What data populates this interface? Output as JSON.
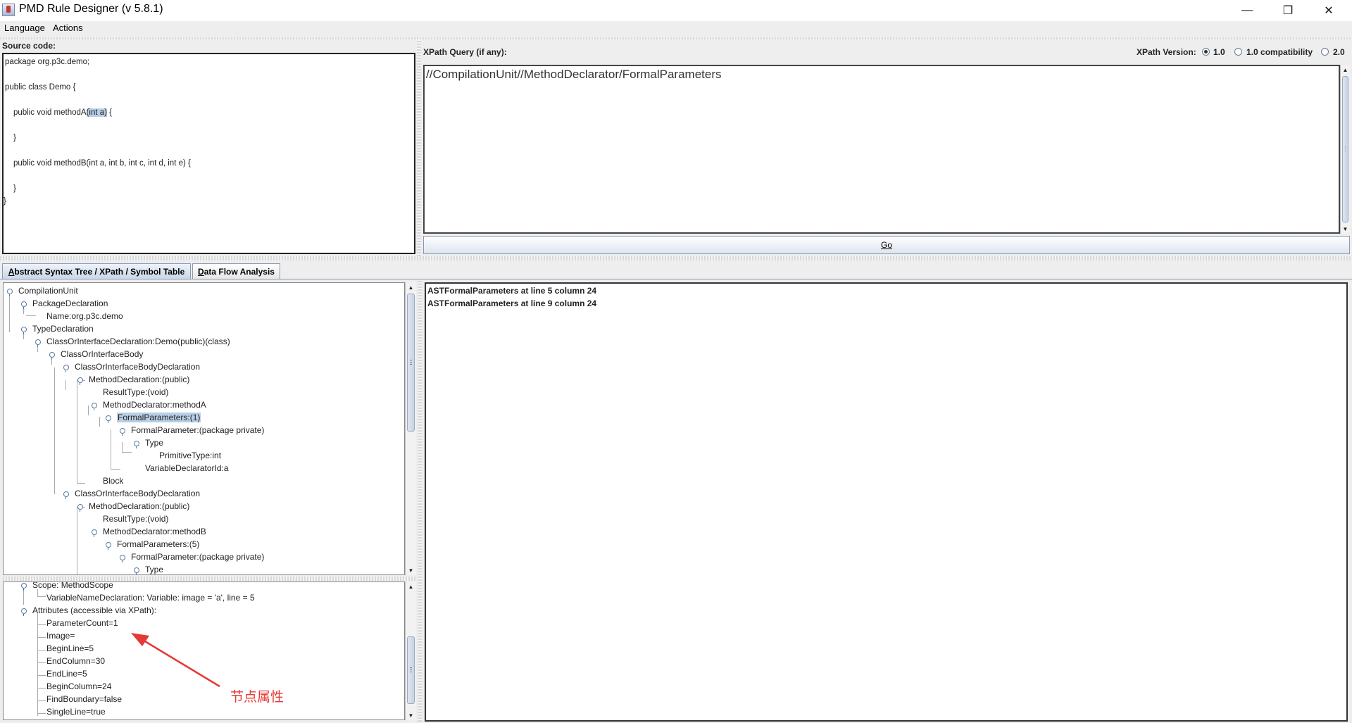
{
  "window": {
    "title": "PMD Rule Designer (v 5.8.1)",
    "controls": {
      "minimize": "—",
      "maximize": "❐",
      "close": "✕"
    }
  },
  "menu": [
    "Language",
    "Actions"
  ],
  "source": {
    "label": "Source code:",
    "lines": [
      "package org.p3c.demo;",
      "public class Demo {",
      "public void methodA",
      "(int a)",
      " {",
      "}",
      "public void methodB(int a, int b, int c, int d, int e) {",
      "}",
      "}"
    ]
  },
  "xpath": {
    "label": "XPath Query (if any):",
    "version_label": "XPath Version:",
    "versions": [
      "1.0",
      "1.0 compatibility",
      "2.0"
    ],
    "selected_version": "1.0",
    "query": "//CompilationUnit//MethodDeclarator/FormalParameters",
    "go_label": "Go"
  },
  "tabs": [
    {
      "label": "Abstract Syntax Tree / XPath / Symbol Table",
      "active": true
    },
    {
      "label": "Data Flow Analysis",
      "active": false
    }
  ],
  "ast_tree": [
    "CompilationUnit",
    "PackageDeclaration",
    "Name:org.p3c.demo",
    "TypeDeclaration",
    "ClassOrInterfaceDeclaration:Demo(public)(class)",
    "ClassOrInterfaceBody",
    "ClassOrInterfaceBodyDeclaration",
    "MethodDeclaration:(public)",
    "ResultType:(void)",
    "MethodDeclarator:methodA",
    "FormalParameters:(1)",
    "FormalParameter:(package private)",
    "Type",
    "PrimitiveType:int",
    "VariableDeclaratorId:a",
    "Block",
    "ClassOrInterfaceBodyDeclaration",
    "MethodDeclaration:(public)",
    "ResultType:(void)",
    "MethodDeclarator:methodB",
    "FormalParameters:(5)",
    "FormalParameter:(package private)",
    "Type"
  ],
  "symbol_tree": [
    "Scope: MethodScope",
    "VariableNameDeclaration: Variable: image = 'a', line = 5",
    "Attributes (accessible via XPath):",
    "ParameterCount=1",
    "Image=",
    "BeginLine=5",
    "EndColumn=30",
    "EndLine=5",
    "BeginColumn=24",
    "FindBoundary=false",
    "SingleLine=true"
  ],
  "results": [
    "ASTFormalParameters at line 5 column 24",
    "ASTFormalParameters at line 9 column 24"
  ],
  "annotation": {
    "label": "节点属性",
    "color": "#e53935"
  }
}
